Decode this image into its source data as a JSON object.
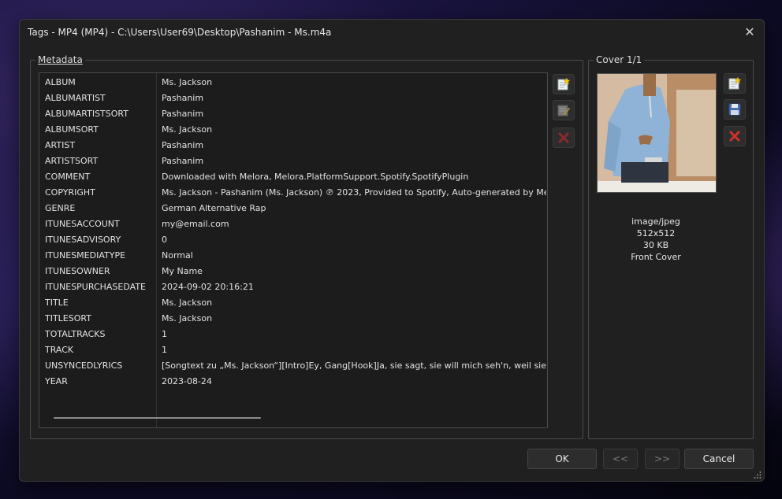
{
  "window": {
    "title": "Tags - MP4 (MP4) - C:\\Users\\User69\\Desktop\\Pashanim - Ms.m4a"
  },
  "metadata": {
    "group_label": "Metadata",
    "rows": [
      {
        "key": "ALBUM",
        "value": "Ms. Jackson"
      },
      {
        "key": "ALBUMARTIST",
        "value": "Pashanim"
      },
      {
        "key": "ALBUMARTISTSORT",
        "value": "Pashanim"
      },
      {
        "key": "ALBUMSORT",
        "value": "Ms. Jackson"
      },
      {
        "key": "ARTIST",
        "value": "Pashanim"
      },
      {
        "key": "ARTISTSORT",
        "value": "Pashanim"
      },
      {
        "key": "COMMENT",
        "value": "Downloaded with Melora, Melora.PlatformSupport.Spotify.SpotifyPlugin"
      },
      {
        "key": "COPYRIGHT",
        "value": "Ms. Jackson - Pashanim (Ms. Jackson) ℗ 2023, Provided to Spotify, Auto-generated by Me"
      },
      {
        "key": "GENRE",
        "value": "German Alternative Rap"
      },
      {
        "key": "ITUNESACCOUNT",
        "value": "my@email.com"
      },
      {
        "key": "ITUNESADVISORY",
        "value": "0"
      },
      {
        "key": "ITUNESMEDIATYPE",
        "value": "Normal"
      },
      {
        "key": "ITUNESOWNER",
        "value": "My Name"
      },
      {
        "key": "ITUNESPURCHASEDATE",
        "value": "2024-09-02 20:16:21"
      },
      {
        "key": "TITLE",
        "value": "Ms. Jackson"
      },
      {
        "key": "TITLESORT",
        "value": "Ms. Jackson"
      },
      {
        "key": "TOTALTRACKS",
        "value": "1"
      },
      {
        "key": "TRACK",
        "value": "1"
      },
      {
        "key": "UNSYNCEDLYRICS",
        "value": "[Songtext zu „Ms. Jackson“][Intro]Ey, Gang[Hook]Ja, sie sagt, sie will mich seh'n, weil sie ka"
      },
      {
        "key": "YEAR",
        "value": "2023-08-24"
      }
    ]
  },
  "cover": {
    "group_label": "Cover 1/1",
    "mime": "image/jpeg",
    "dimensions": "512x512",
    "size": "30 KB",
    "type": "Front Cover"
  },
  "buttons": {
    "ok": "OK",
    "prev": "<<",
    "next": ">>",
    "cancel": "Cancel"
  },
  "icons": {
    "close": "close-icon",
    "meta_add": "add-tag-icon",
    "meta_edit": "edit-tag-icon",
    "meta_delete": "delete-tag-icon",
    "cover_add": "add-cover-icon",
    "cover_save": "save-cover-icon",
    "cover_delete": "delete-cover-icon"
  }
}
